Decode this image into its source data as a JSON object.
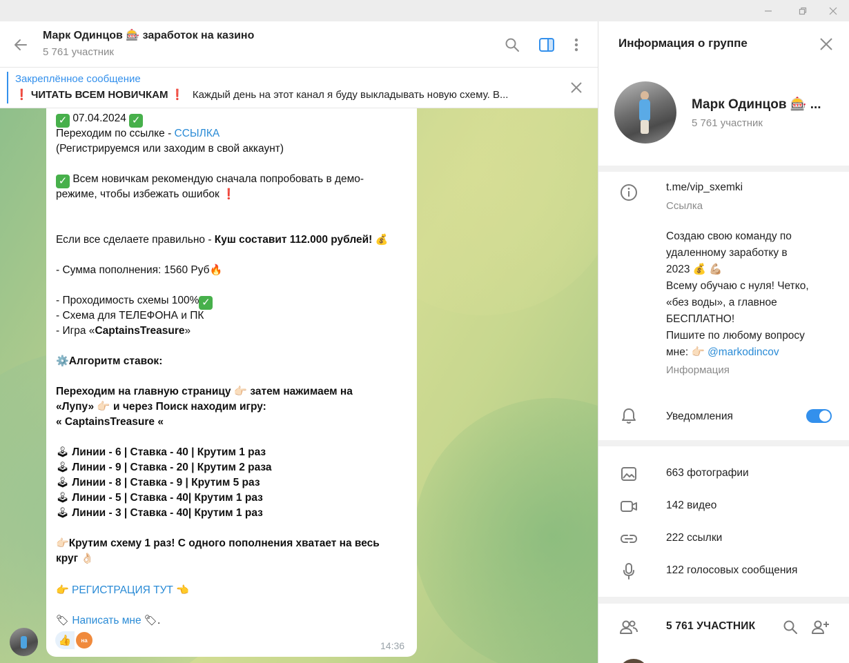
{
  "window": {
    "controls": [
      "minimize",
      "restore",
      "close"
    ]
  },
  "chat": {
    "title": "Марк Одинцов 🎰 заработок на казино",
    "subtitle": "5 761 участник",
    "header_icons": [
      "back-arrow-icon",
      "search-icon",
      "sidebar-toggle-icon",
      "more-vertical-icon"
    ],
    "accent": "#3390ec"
  },
  "pinned": {
    "title": "Закреплённое сообщение",
    "text_bold": "❗ ЧИТАТЬ ВСЕМ НОВИЧКАМ ❗",
    "text_rest": "Каждый день на этот канал я буду выкладывать новую схему. В..."
  },
  "message": {
    "date_line": "07.04.2024",
    "l1_pre": "Переходим по ссылке - ",
    "l1_link": "ССЫЛКА",
    "l2": "(Регистрируемся или заходим в свой аккаунт)",
    "l3": "Всем новичкам рекомендую сначала попробовать в демо-",
    "l4": "режиме, чтобы избежать ошибок",
    "l5_pre": "Если все сделаете правильно - ",
    "l5_bold": "Куш составит 112.000 рублей!",
    "l6": "- Сумма пополнения: 1560 Руб",
    "l7": "- Проходимость схемы 100%",
    "l8": "- Схема для ТЕЛЕФОНА и ПК",
    "l9_pre": "- Игра «",
    "l9_bold": "CaptainsTreasure",
    "l9_post": "»",
    "l10": "Алгоритм ставок:",
    "l11": "Переходим на главную страницу 👉🏻 затем нажимаем на",
    "l12": "«Лупу» 👉🏻 и через Поиск находим игру:",
    "l13": "« CaptainsTreasure «",
    "bets": [
      "Линии -  6  | Ставка - 40 | Крутим 1 раз",
      "Линии -  9  | Ставка - 20 | Крутим 2 раза",
      "Линии -  8  | Ставка - 9   | Крутим 5 раз",
      "Линии -  5  | Ставка - 40|  Крутим 1 раз",
      "Линии -  3  | Ставка - 40| Крутим 1 раз"
    ],
    "l14": "Крутим схему 1 раз! С одного пополнения хватает на весь",
    "l15": "круг",
    "reg_link": "РЕГИСТРАЦИЯ ТУТ",
    "write_link": "Написать мне",
    "time": "14:36",
    "reaction_avatar_label": "на"
  },
  "info": {
    "title": "Информация о группе",
    "group_name": "Марк Одинцов 🎰 ...",
    "group_sub": "5 761 участник",
    "link": "t.me/vip_sxemki",
    "link_label": "Ссылка",
    "about_l1": "Создаю свою команду по",
    "about_l2": "удаленному заработку в",
    "about_l3": "2023 💰 💪🏼",
    "about_l4": "Всему обучаю с нуля! Четко,",
    "about_l5": "«без воды», а главное",
    "about_l6": "БЕСПЛАТНО!",
    "about_l7": "Пишите по любому вопросу",
    "about_l8_pre": "мне: 👉🏻 ",
    "about_l8_link": "@markodincov",
    "about_label": "Информация",
    "notifications": "Уведомления",
    "notifications_on": true,
    "media": [
      {
        "icon": "photo-icon",
        "label": "663 фотографии"
      },
      {
        "icon": "video-icon",
        "label": "142 видео"
      },
      {
        "icon": "link-icon",
        "label": "222 ссылки"
      },
      {
        "icon": "microphone-icon",
        "label": "122 голосовых сообщения"
      }
    ],
    "members_title": "5 761 УЧАСТНИК"
  }
}
